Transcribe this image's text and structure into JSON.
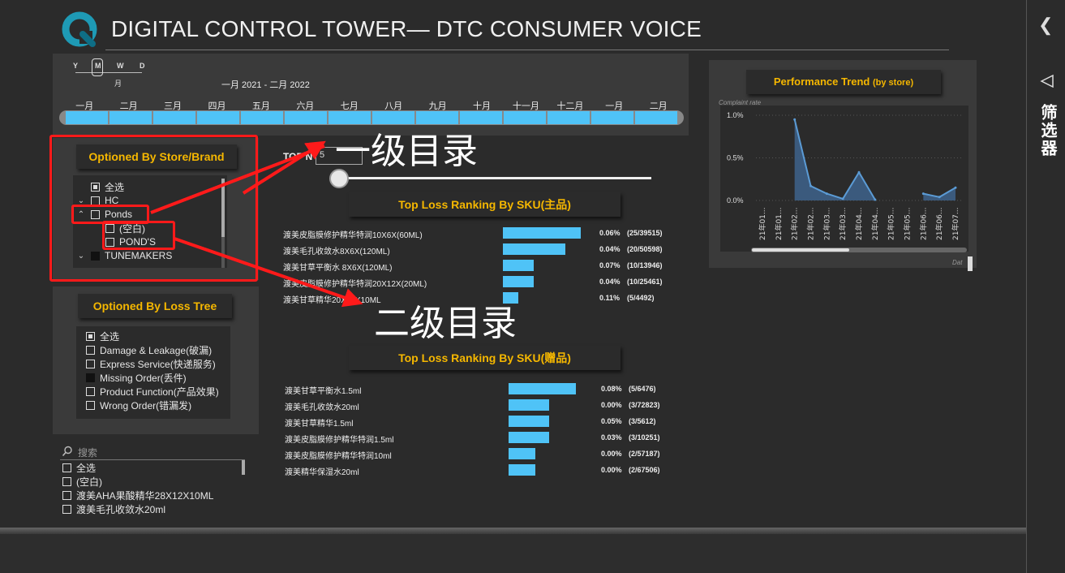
{
  "header": {
    "title": "DIGITAL CONTROL TOWER— DTC CONSUMER VOICE"
  },
  "rail": {
    "label": "筛选器",
    "collapse_icon": "chevron-left-icon",
    "filter_icon": "funnel-icon"
  },
  "timeline": {
    "granularity": [
      "Y",
      "M",
      "W",
      "D"
    ],
    "selected_granularity": "M",
    "selected_label": "月",
    "range": "一月 2021 - 二月 2022",
    "months": [
      "一月",
      "二月",
      "三月",
      "四月",
      "五月",
      "六月",
      "七月",
      "八月",
      "九月",
      "十月",
      "十一月",
      "十二月",
      "一月",
      "二月"
    ]
  },
  "brand_slicer": {
    "title": "Optioned  By Store/Brand",
    "items": [
      {
        "label": "全选",
        "state": "partial",
        "level": 0,
        "expander": ""
      },
      {
        "label": "HC",
        "state": "empty",
        "level": 0,
        "expander": "﹀"
      },
      {
        "label": "Ponds",
        "state": "empty",
        "level": 0,
        "expander": "︿"
      },
      {
        "label": "(空白)",
        "state": "empty",
        "level": 1,
        "expander": ""
      },
      {
        "label": "POND'S",
        "state": "empty",
        "level": 1,
        "expander": ""
      },
      {
        "label": "TUNEMAKERS",
        "state": "filled",
        "level": 0,
        "expander": "﹀"
      }
    ]
  },
  "loss_tree_slicer": {
    "title": "Optioned  By Loss Tree",
    "items": [
      {
        "label": "全选",
        "state": "partial"
      },
      {
        "label": "Damage & Leakage(破漏)",
        "state": "empty"
      },
      {
        "label": "Express Service(快递服务)",
        "state": "empty"
      },
      {
        "label": "Missing Order(丢件)",
        "state": "filled"
      },
      {
        "label": "Product Function(产品效果)",
        "state": "empty"
      },
      {
        "label": "Wrong Order(错漏发)",
        "state": "empty"
      }
    ]
  },
  "sku_search": {
    "placeholder": "搜索",
    "items": [
      {
        "label": "全选"
      },
      {
        "label": "(空白)"
      },
      {
        "label": "渡美AHA果酸精华28X12X10ML"
      },
      {
        "label": "渡美毛孔收敛水20ml"
      }
    ]
  },
  "topn": {
    "label": "TOP N",
    "value": "5"
  },
  "ranking_main": {
    "title": "Top Loss Ranking By SKU(主品)",
    "rows": [
      {
        "name": "渡美皮脂膜修护精华特润10X6X(60ML)",
        "value": 25,
        "pct": "0.06%",
        "count": "(25/39515)"
      },
      {
        "name": "渡美毛孔收敛水8X6X(120ML)",
        "value": 20,
        "pct": "0.04%",
        "count": "(20/50598)"
      },
      {
        "name": "渡美甘草平衡水 8X6X(120ML)",
        "value": 10,
        "pct": "0.07%",
        "count": "(10/13946)"
      },
      {
        "name": "渡美皮脂膜修护精华特润20X12X(20ML)",
        "value": 10,
        "pct": "0.04%",
        "count": "(10/25461)"
      },
      {
        "name": "渡美甘草精华20X12X10ML",
        "value": 5,
        "pct": "0.11%",
        "count": "(5/4492)"
      }
    ]
  },
  "ranking_gift": {
    "title": "Top Loss Ranking By SKU(赠品)",
    "rows": [
      {
        "name": "渡美甘草平衡水1.5ml",
        "value": 5,
        "pct": "0.08%",
        "count": "(5/6476)"
      },
      {
        "name": "渡美毛孔收敛水20ml",
        "value": 3,
        "pct": "0.00%",
        "count": "(3/72823)"
      },
      {
        "name": "渡美甘草精华1.5ml",
        "value": 3,
        "pct": "0.05%",
        "count": "(3/5612)"
      },
      {
        "name": "渡美皮脂膜修护精华特润1.5ml",
        "value": 3,
        "pct": "0.03%",
        "count": "(3/10251)"
      },
      {
        "name": "渡美皮脂膜修护精华特润10ml",
        "value": 2,
        "pct": "0.00%",
        "count": "(2/57187)"
      },
      {
        "name": "渡美精华保湿水20ml",
        "value": 2,
        "pct": "0.00%",
        "count": "(2/67506)"
      }
    ]
  },
  "annotations": {
    "level1": "一级目录",
    "level2": "二级目录",
    "color": "#ff1a1a"
  },
  "performance": {
    "title": "Performance Trend",
    "title_suffix": "(by store)",
    "ylabel": "Complaint rate",
    "xlabel": "Dat",
    "ticks_y": [
      "1.0%",
      "0.5%",
      "0.0%"
    ],
    "x_labels": [
      "21年01...",
      "21年01...",
      "21年02...",
      "21年02...",
      "21年03...",
      "21年03...",
      "21年04...",
      "21年04...",
      "21年05...",
      "21年05...",
      "21年06...",
      "21年06...",
      "21年07..."
    ]
  },
  "chart_data": {
    "type": "area",
    "title": "Performance Trend (by store)",
    "ylabel": "Complaint rate",
    "xlabel": "Dat",
    "ylim": [
      0,
      1.0
    ],
    "y_unit": "%",
    "categories": [
      "21年01...",
      "21年01...",
      "21年02...",
      "21年02...",
      "21年03...",
      "21年03...",
      "21年04...",
      "21年04...",
      "21年05...",
      "21年05...",
      "21年06...",
      "21年06...",
      "21年07..."
    ],
    "series": [
      {
        "values": [
          null,
          null,
          0.95,
          0.17,
          0.08,
          0.02,
          0.33,
          0.01,
          null,
          null,
          0.08,
          0.04,
          0.15
        ]
      }
    ],
    "grid": true,
    "color": "#5b9bd5"
  },
  "colors": {
    "accent": "#f5b700",
    "bar": "#4fc3f7",
    "panel": "#3a3a3a",
    "background": "#2b2b2b"
  }
}
